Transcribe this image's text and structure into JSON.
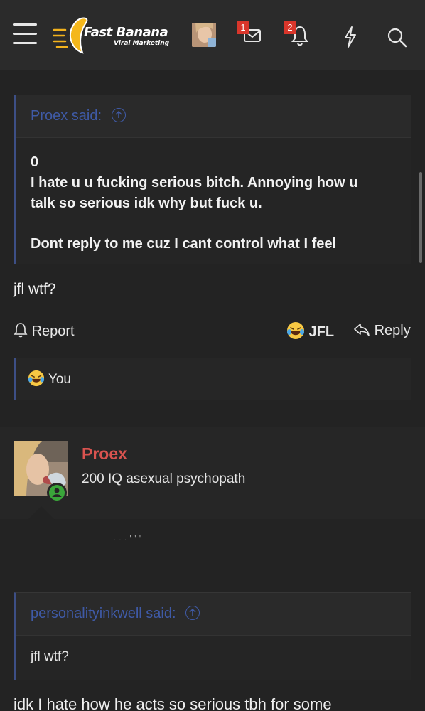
{
  "header": {
    "logo_title": "Fast Banana",
    "logo_subtitle": "Viral Marketing",
    "messages_badge": "1",
    "alerts_badge": "2"
  },
  "post1": {
    "quote_author_label": "Proex said:",
    "quote_lines": [
      "0",
      "I hate u u fucking serious bitch. Annoying how u",
      "talk so serious idk why but fuck u.",
      "Dont reply to me cuz I cant control what I feel"
    ],
    "message": "jfl wtf?",
    "report_label": "Report",
    "reaction_label": "JFL",
    "reply_label": "Reply",
    "reactions_by": "You"
  },
  "post2": {
    "username": "Proex",
    "user_title": "200 IQ asexual psychopath",
    "partial_text": ". . . ' ' '",
    "quote_author_label": "personalityinkwell said:",
    "quote_text": "jfl wtf?",
    "message_start": "idk I hate how he acts so serious tbh for some"
  },
  "colors": {
    "accent_quote": "#3f5aa6",
    "username": "#d9534f",
    "online": "#3aa63a",
    "badge": "#d9362b"
  }
}
